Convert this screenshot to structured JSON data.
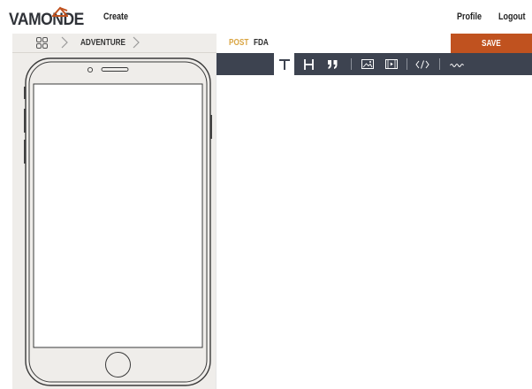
{
  "app": {
    "logo_text": "VAMONDE"
  },
  "nav": {
    "create": "Create",
    "profile": "Profile",
    "logout": "Logout"
  },
  "breadcrumb": {
    "category": "ADVENTURE"
  },
  "post": {
    "type_label": "POST",
    "name": "FDA"
  },
  "actions": {
    "save": "SAVE"
  },
  "toolbar": {
    "tools": [
      "text-icon",
      "heading-icon",
      "quote-icon",
      "image-icon",
      "video-icon",
      "code-icon",
      "divider-wave-icon"
    ],
    "active": "text-icon"
  },
  "colors": {
    "accent": "#c0521f",
    "post_label": "#d9a441",
    "toolbar_bg": "#3d4350",
    "panel_bg": "#efedea",
    "logo_mark": "#c0521f"
  }
}
